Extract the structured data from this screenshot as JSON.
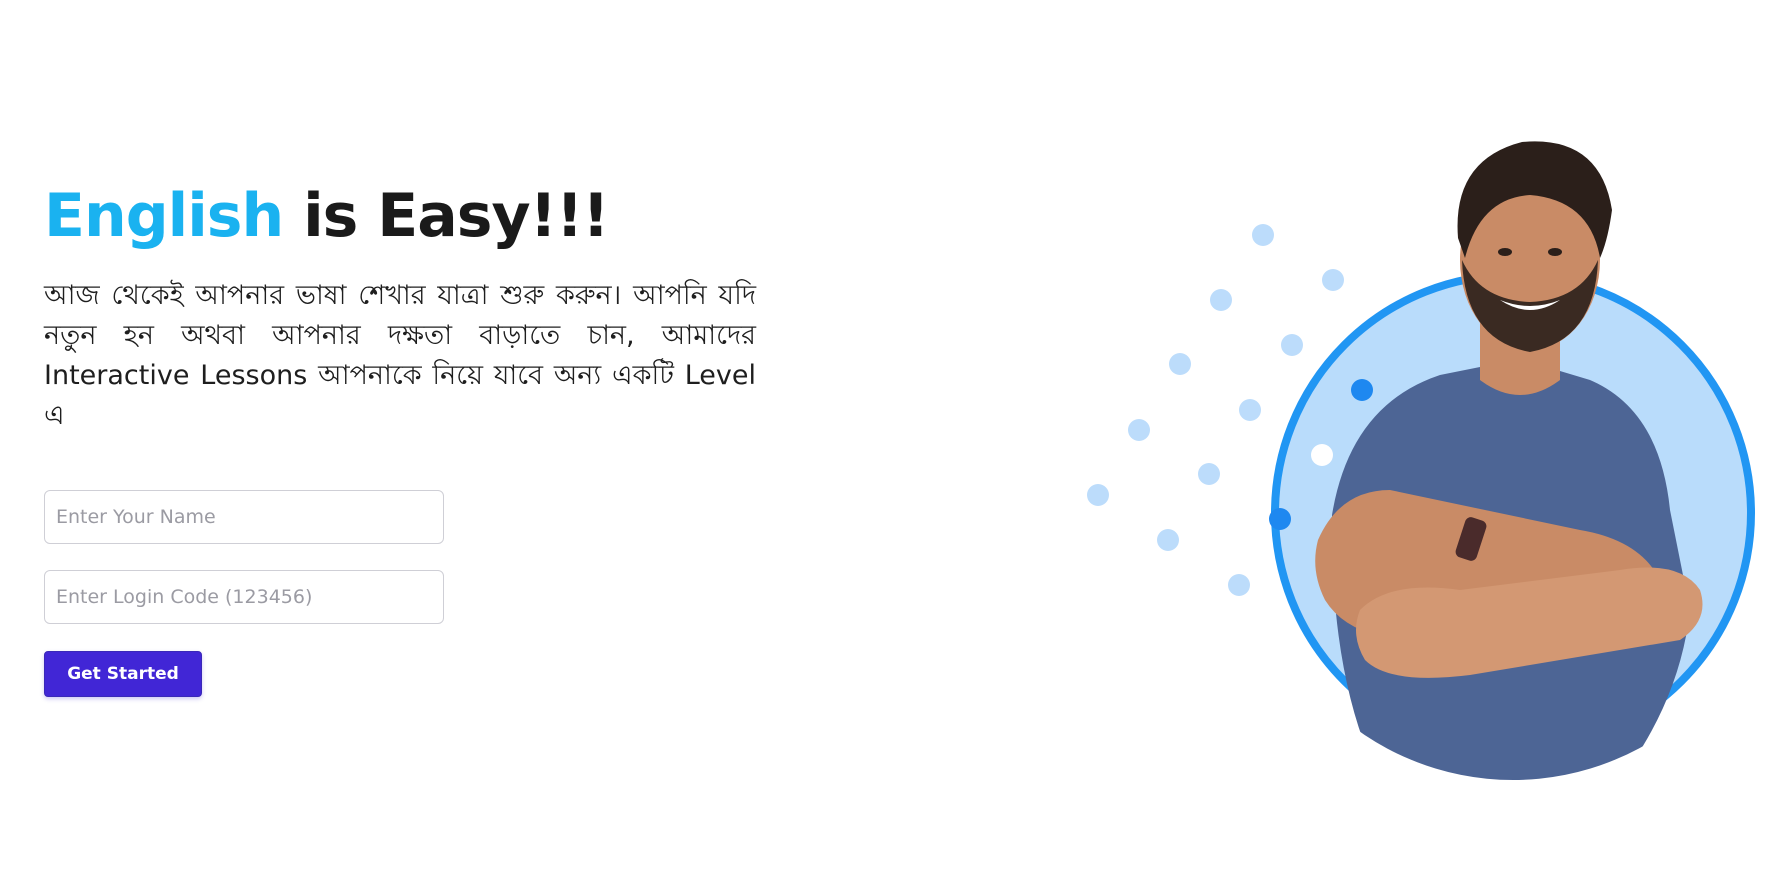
{
  "hero": {
    "title_accent": "English",
    "title_rest": " is Easy!!!",
    "description": "আজ থেকেই আপনার ভাষা শেখার যাত্রা শুরু করুন। আপনি যদি নতুন হন অথবা আপনার দক্ষতা বাড়াতে চান, আমাদের Interactive Lessons আপনাকে নিয়ে যাবে অন্য একটি Level এ"
  },
  "form": {
    "name_placeholder": "Enter Your Name",
    "name_value": "",
    "code_placeholder": "Enter Login Code (123456)",
    "code_value": "",
    "submit_label": "Get Started"
  },
  "colors": {
    "accent": "#1ab2f0",
    "button": "#4126d6",
    "ring": "#2196f3",
    "circle_fill": "#b9dcfb",
    "dot_light": "#bcdcfb",
    "dot_dark": "#1e88f0"
  },
  "illustration": {
    "icon": "smiling-man-arms-crossed-portrait"
  }
}
